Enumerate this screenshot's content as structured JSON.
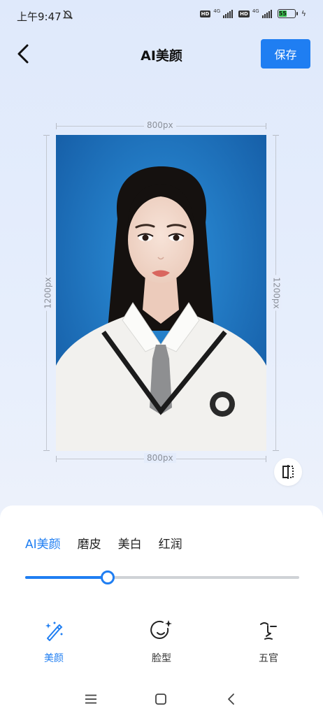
{
  "status_bar": {
    "time": "上午9:47",
    "hd": "HD",
    "network": "4G",
    "battery_text": "55",
    "battery_level": 0.55,
    "battery_color": "#35c24a"
  },
  "header": {
    "title": "AI美颜",
    "save_label": "保存"
  },
  "canvas": {
    "width_label": "800px",
    "height_label": "1200px",
    "photo_bg_color": "#1c6fbe"
  },
  "beauty_tabs": [
    {
      "label": "AI美颜",
      "active": true
    },
    {
      "label": "磨皮",
      "active": false
    },
    {
      "label": "美白",
      "active": false
    },
    {
      "label": "红润",
      "active": false
    }
  ],
  "slider": {
    "value": 0.3
  },
  "tools": [
    {
      "label": "美颜",
      "icon": "magic-wand-icon",
      "active": true
    },
    {
      "label": "脸型",
      "icon": "face-sparkle-icon",
      "active": false
    },
    {
      "label": "五官",
      "icon": "facial-features-icon",
      "active": false
    }
  ],
  "colors": {
    "accent": "#1f7ef2"
  },
  "system_nav": [
    "menu-icon",
    "home-icon",
    "back-icon"
  ]
}
